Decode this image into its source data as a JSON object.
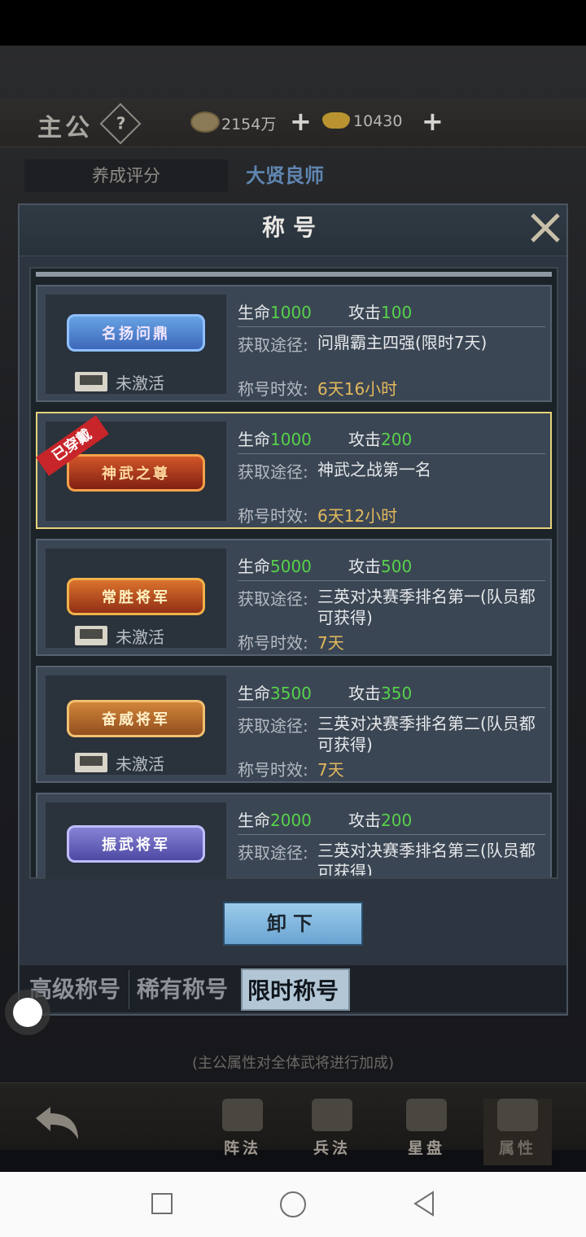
{
  "topbar": {
    "lord_label": "主公",
    "help_symbol": "?",
    "copper_value": "2154万",
    "gold_value": "10430",
    "plus_symbol": "+",
    "score_tab": "养成评分",
    "title_name": "大贤良师"
  },
  "dialog": {
    "title": "称号",
    "source_label": "获取途径:",
    "time_label": "称号时效:",
    "hp_label": "生命",
    "atk_label": "攻击",
    "inactive_label": "未激活",
    "equipped_ribbon": "已穿戴",
    "cards": [
      {
        "badge": "名扬问鼎",
        "hp": "1000",
        "atk": "100",
        "source": "问鼎霸主四强(限时7天)",
        "time": "6天16小时",
        "status": "未激活"
      },
      {
        "badge": "神武之尊",
        "hp": "1000",
        "atk": "200",
        "source": "神武之战第一名",
        "time": "6天12小时",
        "status": "已穿戴"
      },
      {
        "badge": "常胜将军",
        "hp": "5000",
        "atk": "500",
        "source": "三英对决赛季排名第一(队员都可获得)",
        "time": "7天",
        "status": "未激活"
      },
      {
        "badge": "奋威将军",
        "hp": "3500",
        "atk": "350",
        "source": "三英对决赛季排名第二(队员都可获得)",
        "time": "7天",
        "status": "未激活"
      },
      {
        "badge": "振武将军",
        "hp": "2000",
        "atk": "200",
        "source": "三英对决赛季排名第三(队员都可获得)",
        "time": "",
        "status": ""
      }
    ],
    "unequip_button": "卸下",
    "tabs": [
      "高级称号",
      "稀有称号",
      "限时称号"
    ],
    "active_tab": "限时称号"
  },
  "hint": "(主公属性对全体武将进行加成)",
  "bottom_nav": {
    "items": [
      "阵法",
      "兵法",
      "星盘",
      "属性"
    ],
    "active": "属性"
  },
  "colors": {
    "stat_value": "#56d24a",
    "time_value": "#e3b95c",
    "selected_border": "#e6d37a",
    "ribbon": "#c7252a",
    "button": "#8cc0e4"
  }
}
